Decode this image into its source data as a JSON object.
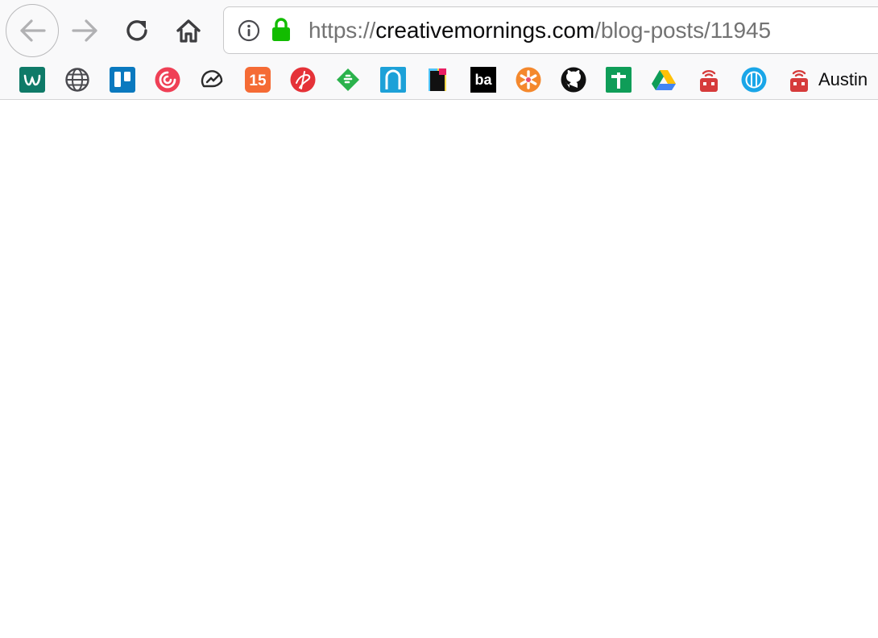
{
  "browser": {
    "nav": {
      "back_icon": "arrow-left-icon",
      "forward_icon": "arrow-right-icon",
      "reload_icon": "reload-icon",
      "home_icon": "home-icon"
    },
    "urlbar": {
      "info_icon": "info-icon",
      "lock_icon": "padlock-icon",
      "lock_color": "#12bc00",
      "url_scheme": "https://",
      "url_domain": "creativemornings.com",
      "url_path": "/blog-posts/11945"
    },
    "bookmarks": {
      "items": [
        {
          "icon": "w-logo-icon",
          "color": "#0f7a68"
        },
        {
          "icon": "globe-icon",
          "color": "#4a4a4f"
        },
        {
          "icon": "trello-icon",
          "color": "#0a79bf"
        },
        {
          "icon": "pocket-icon",
          "color": "#ef4056"
        },
        {
          "icon": "analytics-gauge-icon",
          "color": "#2c2c2c"
        },
        {
          "icon": "calendar-15-icon",
          "color": "#f56b35",
          "label": "15"
        },
        {
          "icon": "red-swirl-icon",
          "color": "#e53238"
        },
        {
          "icon": "feedly-icon",
          "color": "#2bb24c"
        },
        {
          "icon": "n-arch-icon",
          "color": "#1da1d8"
        },
        {
          "icon": "color-book-icon",
          "color": "#111111"
        },
        {
          "icon": "ba-icon",
          "color": "#000000",
          "label": "ba"
        },
        {
          "icon": "asterisk-flower-icon",
          "color": "#f4882d"
        },
        {
          "icon": "github-icon",
          "color": "#111111"
        },
        {
          "icon": "green-plus-icon",
          "color": "#0f9d58"
        },
        {
          "icon": "google-drive-icon",
          "color": "#4285f4"
        },
        {
          "icon": "radio-robot-icon",
          "color": "#d63b3b"
        },
        {
          "icon": "blue-badge-icon",
          "color": "#1aa6e8"
        },
        {
          "icon": "radio-robot-icon",
          "color": "#d63b3b"
        }
      ],
      "last_label": "Austin"
    }
  }
}
